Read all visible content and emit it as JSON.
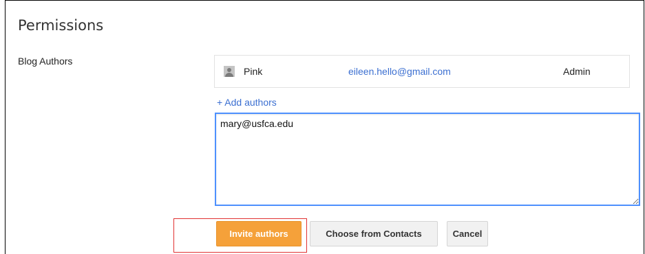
{
  "page": {
    "title": "Permissions"
  },
  "blog_authors": {
    "label": "Blog Authors",
    "authors": [
      {
        "name": "Pink",
        "email": "eileen.hello@gmail.com",
        "role": "Admin",
        "avatar_icon": "user-silhouette-icon"
      }
    ],
    "add_authors_link": "+ Add authors",
    "input_value": "mary@usfca.edu"
  },
  "actions": {
    "invite_label": "Invite authors",
    "contacts_label": "Choose from Contacts",
    "cancel_label": "Cancel"
  },
  "colors": {
    "accent_orange": "#f5a13a",
    "link_blue": "#3b6fd1",
    "focus_blue": "#4d90fe",
    "highlight_red": "#e03030"
  }
}
